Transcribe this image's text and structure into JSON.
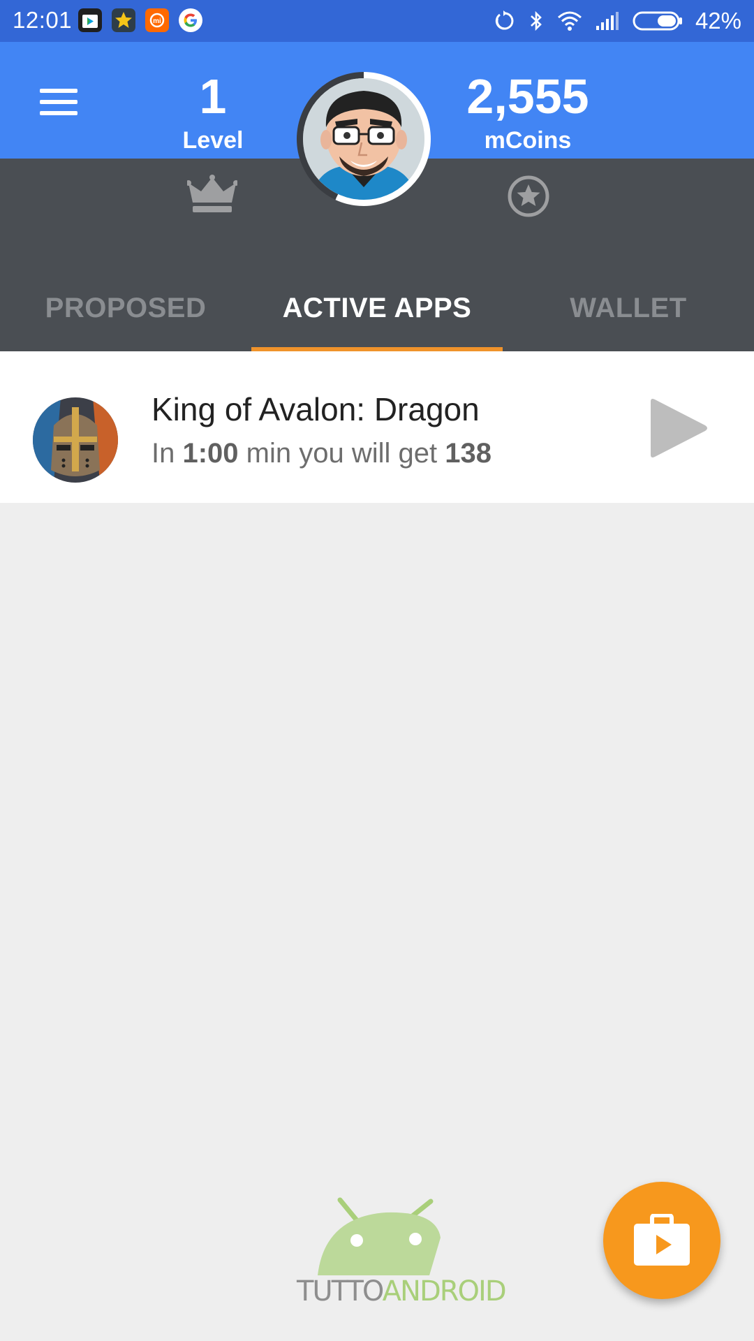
{
  "status_bar": {
    "time": "12:01",
    "battery_percent": "42%",
    "icons": [
      "play-store-icon",
      "star-app-icon",
      "mi-icon",
      "google-icon",
      "sync-icon",
      "bluetooth-icon",
      "wifi-icon",
      "signal-icon",
      "battery-icon"
    ]
  },
  "header": {
    "level_value": "1",
    "level_label": "Level",
    "coins_value": "2,555",
    "coins_label": "mCoins",
    "level_progress": 0.57
  },
  "tabs": [
    {
      "label": "PROPOSED",
      "active": false
    },
    {
      "label": "ACTIVE APPS",
      "active": true
    },
    {
      "label": "WALLET",
      "active": false
    }
  ],
  "active_apps": [
    {
      "title": "King of Avalon: Dragon",
      "sub_prefix": "In ",
      "time": "1:00",
      "sub_mid": " min you will get ",
      "reward": "138"
    }
  ],
  "watermark": {
    "part1": "TUTTO",
    "part2": "ANDROID"
  },
  "colors": {
    "status_bar": "#3367d6",
    "header_blue": "#4285f4",
    "header_dark": "#4a4e53",
    "accent_orange": "#f0932b",
    "fab_orange": "#f7981d",
    "background": "#eeeeee"
  }
}
